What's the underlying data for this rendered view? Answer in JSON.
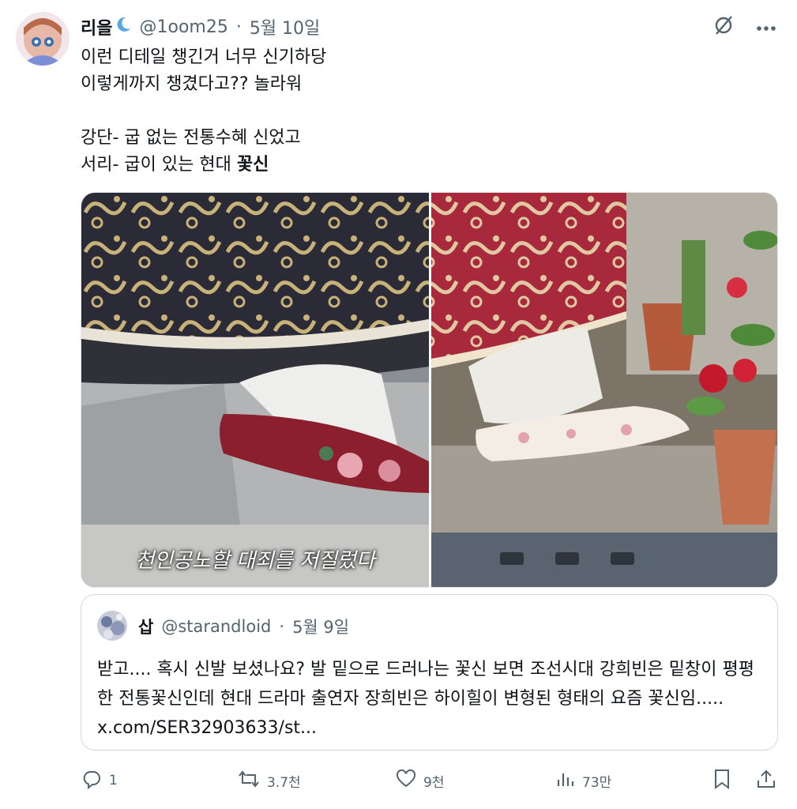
{
  "author": {
    "display_name": "리을",
    "handle": "@1oom25",
    "date": "5월 10일"
  },
  "tweet": {
    "line1": "이런 디테일 챙긴거 너무 신기하당",
    "line2": "이렇게까지 챙겼다고?? 놀라워",
    "line3": "강단- 굽 없는 전통수혜 신었고",
    "line4_prefix": "서리- 굽이 있는 현대 ",
    "line4_bold": "꽃신"
  },
  "media": {
    "caption": "천인공노할 대죄를 저질렀다"
  },
  "quoted": {
    "display_name": "삽",
    "handle": "@starandloid",
    "date": "5월 9일",
    "text": "받고.... 혹시 신발 보셨나요? 발 밑으로 드러나는 꽃신 보면 조선시대 강희빈은 밑창이 평평한 전통꽃신인데 현대 드라마 출연자 장희빈은 하이힐이 변형된 형태의 요즘 꽃신임..... x.com/SER32903633/st..."
  },
  "actions": {
    "reply_count": "1",
    "retweet_count": "3.7천",
    "like_count": "9천",
    "view_count": "73만"
  },
  "icons": [
    "grok-icon",
    "more-icon",
    "reply-icon",
    "retweet-icon",
    "like-icon",
    "views-icon",
    "bookmark-icon",
    "share-icon",
    "moon-emoji-icon"
  ],
  "colors": {
    "text": "#0f1419",
    "muted": "#536471",
    "border": "#cfd9de"
  }
}
